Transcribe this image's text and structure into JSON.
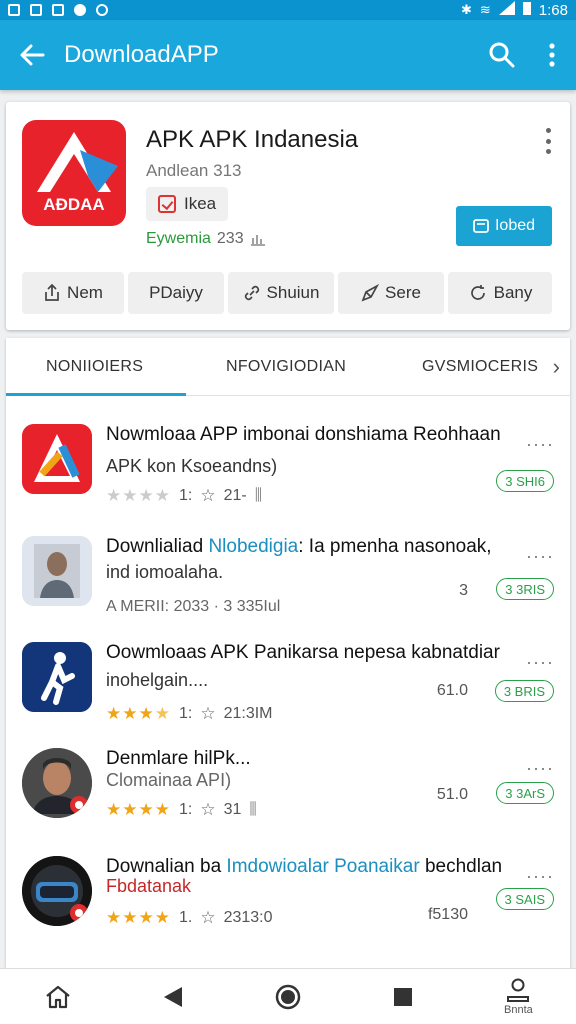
{
  "status_bar": {
    "time": "1:68"
  },
  "app_bar": {
    "title": "DownloadAPP"
  },
  "app_card": {
    "name": "APK APK Indanesia",
    "subtitle": "Andlean 313",
    "chip_label": "Ikea",
    "meta_green": "Eywemia",
    "meta_rest": "233",
    "logo_text": "AƉDAA",
    "install_label": "Iobed",
    "actions": [
      {
        "label": "Nem",
        "icon": "share-icon"
      },
      {
        "label": "PDaiyy",
        "icon": ""
      },
      {
        "label": "Shuiun",
        "icon": "link-icon"
      },
      {
        "label": "Sere",
        "icon": "send-icon"
      },
      {
        "label": "Bany",
        "icon": "refresh-icon"
      }
    ]
  },
  "tabs": [
    {
      "label": "NONIIOIЕRS"
    },
    {
      "label": "NFOVIGIODIAN"
    },
    {
      "label": "GVSMIOCERIS"
    }
  ],
  "list": [
    {
      "title_a": "Nowmloaa APP imbonai donshiama Reohhaan",
      "title_blue": "",
      "title_b": "",
      "sub": "APK kon Ksoeandns)",
      "sub_style": "normal",
      "stars_filled": 0,
      "rating_text": "1:",
      "meta": "21-",
      "size": "",
      "badge": "3 SHI6",
      "more": "····"
    },
    {
      "title_a": "Downlialiad ",
      "title_blue": "Nlobedigia",
      "title_b": ": Ia pmenha nasonoak,",
      "sub": "ind iomoalaha.",
      "sub_style": "normal",
      "stars_filled": -1,
      "rating_text": "A MERII: 2033 · 3 335Iul",
      "meta": "",
      "size": "3",
      "badge": "3 3RIS",
      "more": "····"
    },
    {
      "title_a": "Oowmloaas APK Panikarsa nepesa kabnatdiar",
      "title_blue": "",
      "title_b": "",
      "sub": "inohelgain....",
      "sub_style": "normal",
      "stars_filled": 3,
      "rating_text": "1:",
      "meta": "21:3IM",
      "size": "61.0",
      "badge": "3 BRIS",
      "more": "····"
    },
    {
      "title_a": "Denmlare hilPk...",
      "title_blue": "",
      "title_b": "",
      "sub": "Clomainaa API)",
      "sub_style": "grey",
      "stars_filled": 4,
      "rating_text": "1:",
      "meta": "31",
      "size": "51.0",
      "badge": "3 3ArS",
      "more": "····"
    },
    {
      "title_a": "Downalian ba ",
      "title_blue": "Imdowioalar Poanaikar",
      "title_b": " bechdlan",
      "sub": "Fbdatanak",
      "sub_style": "red",
      "stars_filled": 4,
      "rating_text": "1.",
      "meta": "2313:0",
      "size": "f5130",
      "badge": "3 SAIS",
      "more": "····"
    }
  ],
  "bottom_nav": {
    "items": [
      {
        "icon": "home-icon",
        "label": ""
      },
      {
        "icon": "back-triangle-icon",
        "label": ""
      },
      {
        "icon": "home-circle-icon",
        "label": ""
      },
      {
        "icon": "recents-square-icon",
        "label": ""
      },
      {
        "icon": "profile-icon",
        "label": "Bnnta"
      }
    ]
  },
  "colors": {
    "accent": "#19a7dc",
    "status_bar": "#0b93cf",
    "badge_green": "#2aa04a",
    "star_gold": "#f2a416",
    "logo_red": "#e8222b"
  }
}
